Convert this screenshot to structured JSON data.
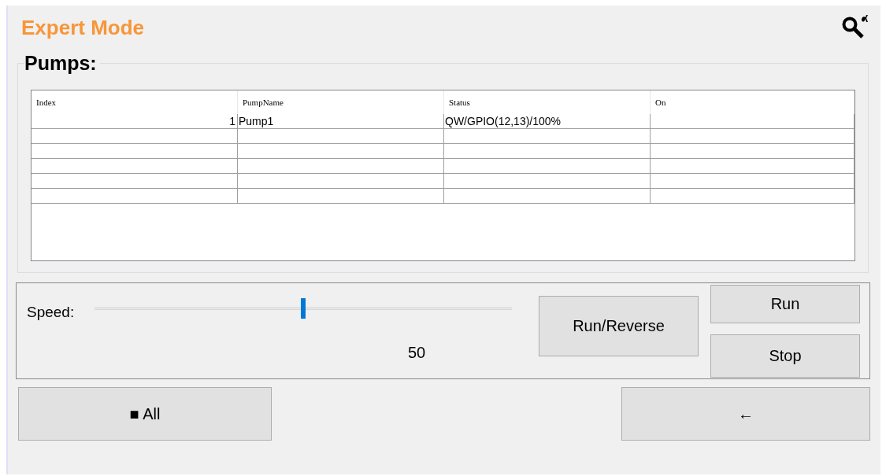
{
  "title": "Expert Mode",
  "pumps": {
    "title": "Pumps:",
    "columns": [
      "Index",
      "PumpName",
      "Status",
      "On"
    ],
    "rows": [
      {
        "index": "1",
        "name": "Pump1",
        "status": "QW/GPIO(12,13)/100%"
      }
    ]
  },
  "speed": {
    "label": "Speed:",
    "level": 0.5,
    "reading": "50"
  },
  "buttons": [
    {
      "kind": "reverse",
      "label": "Run/Reverse"
    },
    {
      "kind": "run",
      "label": "Run"
    },
    {
      "kind": "stop",
      "label": "Stop"
    }
  ],
  "bottom_buttons": [
    {
      "kind": "all",
      "label": "■ All"
    },
    {
      "kind": "back",
      "label": "←"
    }
  ]
}
